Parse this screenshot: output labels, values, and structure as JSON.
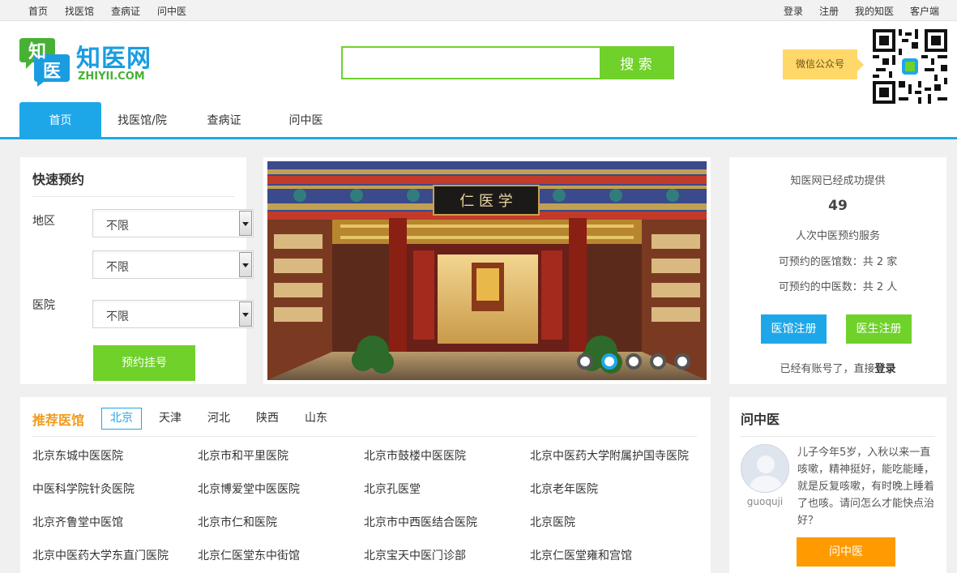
{
  "topbar": {
    "left_links": [
      "首页",
      "找医馆",
      "查病证",
      "问中医"
    ],
    "right_links": [
      "登录",
      "注册",
      "我的知医",
      "客户端"
    ]
  },
  "logo": {
    "glyph_top": "知",
    "glyph_bottom": "医",
    "name_cn": "知医网",
    "name_en": "ZHIYII.COM"
  },
  "search": {
    "value": "",
    "placeholder": "",
    "button_label": "搜 索"
  },
  "wechat": {
    "label": "微信公众号",
    "icon": "qr-code-icon"
  },
  "nav": {
    "tabs": [
      {
        "label": "首页",
        "active": true
      },
      {
        "label": "找医馆/院",
        "active": false
      },
      {
        "label": "查病证",
        "active": false
      },
      {
        "label": "问中医",
        "active": false
      }
    ]
  },
  "quick_booking": {
    "title": "快速预约",
    "region_label": "地区",
    "hospital_label": "医院",
    "region_select_1": "不限",
    "region_select_2": "不限",
    "hospital_select": "不限",
    "submit_label": "预约挂号"
  },
  "banner": {
    "sign_text": "仁 医 学",
    "slides_count": 5,
    "active_slide": 2
  },
  "stats": {
    "line1": "知医网已经成功提供",
    "count": "49",
    "line2": "人次中医预约服务",
    "clinics_line": "可预约的医馆数：共 2 家",
    "doctors_line": "可预约的中医数：共 2 人",
    "clinic_register": "医馆注册",
    "doctor_register": "医生注册",
    "login_prefix": "已经有账号了，直接",
    "login_link": "登录"
  },
  "recommended": {
    "title": "推荐医馆",
    "regions": [
      {
        "label": "北京",
        "active": true
      },
      {
        "label": "天津",
        "active": false
      },
      {
        "label": "河北",
        "active": false
      },
      {
        "label": "陕西",
        "active": false
      },
      {
        "label": "山东",
        "active": false
      }
    ],
    "clinics": [
      "北京东城中医医院",
      "北京市和平里医院",
      "北京市鼓楼中医医院",
      "北京中医药大学附属护国寺医院",
      "中医科学院针灸医院",
      "北京博爱堂中医医院",
      "北京孔医堂",
      "北京老年医院",
      "北京齐鲁堂中医馆",
      "北京市仁和医院",
      "北京市中西医结合医院",
      "北京医院",
      "北京中医药大学东直门医院",
      "北京仁医堂东中街馆",
      "北京宝天中医门诊部",
      "北京仁医堂雍和宫馆"
    ]
  },
  "ask": {
    "title": "问中医",
    "username": "guoquji",
    "question": "儿子今年5岁，入秋以来一直咳嗽，精神挺好，能吃能睡，就是反复咳嗽，有时晚上睡着了也咳。请问怎么才能快点治好？",
    "button_label": "问中医"
  },
  "colors": {
    "brand_blue": "#1ea7e8",
    "brand_green": "#6fd12a",
    "accent_orange": "#f39a1a",
    "button_orange": "#ff9a00",
    "wechat_yellow": "#ffd869"
  }
}
